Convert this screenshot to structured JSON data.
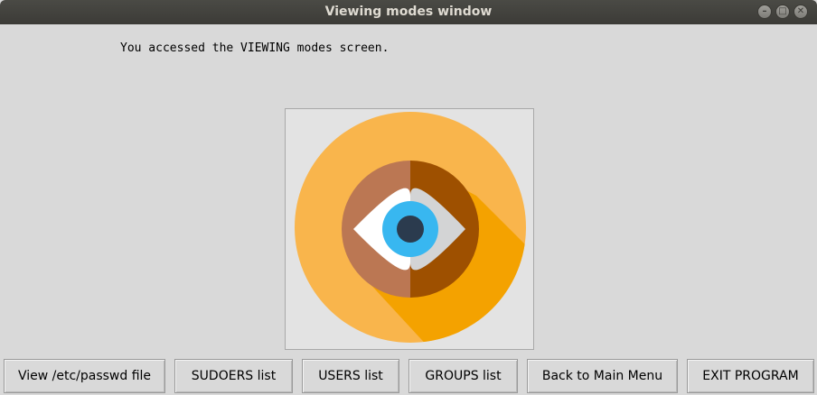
{
  "window": {
    "title": "Viewing modes window",
    "controls": {
      "minimize_glyph": "–",
      "maximize_glyph": "□",
      "close_glyph": "✕"
    }
  },
  "main": {
    "message": "You accessed the VIEWING modes screen.",
    "image_icon": "eye-icon",
    "image_colors": {
      "outer_circle": "#f9b54c",
      "shadow": "#f4a200",
      "inner_left": "#bb7753",
      "inner_right": "#9e5000",
      "eye_white": "#ffffff",
      "eye_white_shade": "#d3d4d5",
      "iris": "#38b7f0",
      "pupil": "#2b3b4e"
    }
  },
  "buttons": [
    {
      "label": "View /etc/passwd file"
    },
    {
      "label": "SUDOERS list"
    },
    {
      "label": "USERS list"
    },
    {
      "label": "GROUPS list"
    },
    {
      "label": "Back to Main Menu"
    },
    {
      "label": "EXIT PROGRAM"
    }
  ]
}
